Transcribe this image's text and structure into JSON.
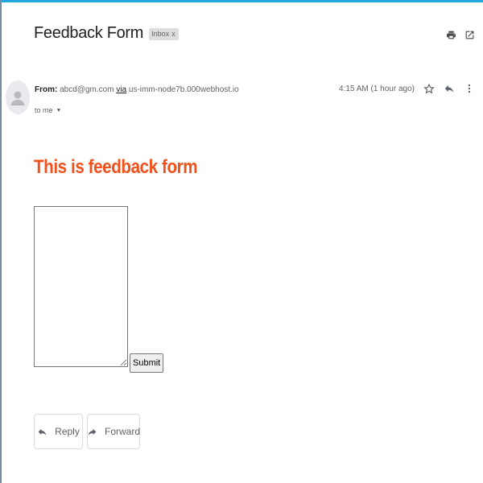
{
  "email": {
    "subject": "Feedback Form",
    "label": "Inbox",
    "label_close": "x",
    "from_label": "From:",
    "from_address": "abcd@gm.com",
    "via_label": "via",
    "via_host": "us-imm-node7b.000webhost.io",
    "to_text": "to me",
    "to_caret": "▼",
    "timestamp": "4:15 AM (1 hour ago)"
  },
  "body": {
    "heading": "This is feedback form",
    "heading_color": "#f2511b",
    "textarea_value": "",
    "submit_label": "Submit"
  },
  "actions": {
    "reply_label": "Reply",
    "forward_label": "Forward"
  },
  "icons": {
    "print": "print-icon",
    "open_new_window": "open-in-new-window-icon",
    "star": "star-icon",
    "reply": "reply-icon",
    "more": "more-vert-icon",
    "forward": "forward-icon",
    "avatar": "person-avatar-icon"
  },
  "colors": {
    "accent": "#22a7e0",
    "heading": "#f2511b",
    "muted_text": "#5f6368"
  }
}
